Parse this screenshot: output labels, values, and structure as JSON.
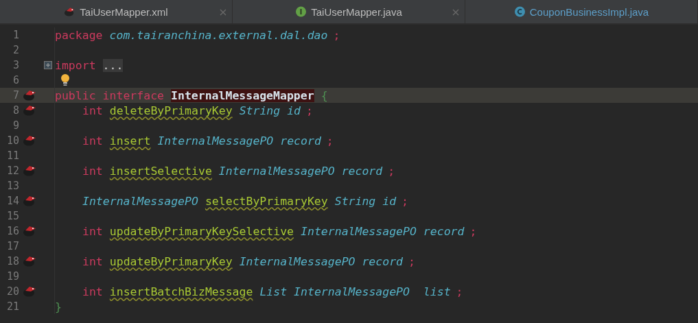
{
  "tabs": [
    {
      "label": "TaiUserMapper.xml",
      "kind": "bird",
      "selected": false,
      "modified": false,
      "closable": true
    },
    {
      "label": "TaiUserMapper.java",
      "kind": "interface",
      "selected": false,
      "modified": false,
      "closable": true
    },
    {
      "label": "CouponBusinessImpl.java",
      "kind": "class",
      "selected": false,
      "modified": true,
      "closable": false
    }
  ],
  "editor": {
    "lines": [
      {
        "number": "1",
        "kind": "plain",
        "current": false,
        "indented": false,
        "tokens": [
          {
            "text": "package",
            "kind": "keyword"
          },
          {
            "text": "com.tairanchina.external.dal.dao",
            "kind": "ident"
          },
          {
            "text": ";",
            "kind": "punct"
          }
        ]
      },
      {
        "number": "2",
        "kind": "plain",
        "current": false
      },
      {
        "number": "3",
        "kind": "fold",
        "current": false,
        "indented": false,
        "tokens": [
          {
            "text": "import",
            "kind": "keyword"
          },
          {
            "text": "...",
            "kind": "folded"
          }
        ]
      },
      {
        "number": "6",
        "kind": "bulb",
        "current": false,
        "indented": false
      },
      {
        "number": "7",
        "kind": "mapper",
        "current": true,
        "indented": false,
        "tokens": [
          {
            "text": "public",
            "kind": "keyword"
          },
          {
            "text": "interface",
            "kind": "keyword"
          },
          {
            "text": "InternalMessageMapper",
            "kind": "declared"
          },
          {
            "text": "{",
            "kind": "brace"
          }
        ]
      },
      {
        "number": "8",
        "kind": "mapper",
        "current": false,
        "indented": true,
        "tokens": [
          {
            "text": "int",
            "kind": "keyword"
          },
          {
            "text": "deleteByPrimaryKey",
            "kind": "method"
          },
          {
            "text": "String id",
            "kind": "ident"
          },
          {
            "text": ";",
            "kind": "punct"
          }
        ]
      },
      {
        "number": "9",
        "kind": "plain",
        "current": false
      },
      {
        "number": "10",
        "kind": "mapper",
        "current": false,
        "indented": true,
        "tokens": [
          {
            "text": "int",
            "kind": "keyword"
          },
          {
            "text": "insert",
            "kind": "method"
          },
          {
            "text": "InternalMessagePO record",
            "kind": "ident"
          },
          {
            "text": ";",
            "kind": "punct"
          }
        ]
      },
      {
        "number": "11",
        "kind": "plain",
        "current": false
      },
      {
        "number": "12",
        "kind": "mapper",
        "current": false,
        "indented": true,
        "tokens": [
          {
            "text": "int",
            "kind": "keyword"
          },
          {
            "text": "insertSelective",
            "kind": "method"
          },
          {
            "text": "InternalMessagePO record",
            "kind": "ident"
          },
          {
            "text": ";",
            "kind": "punct"
          }
        ]
      },
      {
        "number": "13",
        "kind": "plain",
        "current": false
      },
      {
        "number": "14",
        "kind": "mapper",
        "current": false,
        "indented": true,
        "tokens": [
          {
            "text": "InternalMessagePO",
            "kind": "ident"
          },
          {
            "text": "selectByPrimaryKey",
            "kind": "method"
          },
          {
            "text": "String id",
            "kind": "ident"
          },
          {
            "text": ";",
            "kind": "punct"
          }
        ]
      },
      {
        "number": "15",
        "kind": "plain",
        "current": false
      },
      {
        "number": "16",
        "kind": "mapper",
        "current": false,
        "indented": true,
        "tokens": [
          {
            "text": "int",
            "kind": "keyword"
          },
          {
            "text": "updateByPrimaryKeySelective",
            "kind": "method"
          },
          {
            "text": "InternalMessagePO record",
            "kind": "ident"
          },
          {
            "text": ";",
            "kind": "punct"
          }
        ]
      },
      {
        "number": "17",
        "kind": "plain",
        "current": false
      },
      {
        "number": "18",
        "kind": "mapper",
        "current": false,
        "indented": true,
        "tokens": [
          {
            "text": "int",
            "kind": "keyword"
          },
          {
            "text": "updateByPrimaryKey",
            "kind": "method"
          },
          {
            "text": "InternalMessagePO record",
            "kind": "ident"
          },
          {
            "text": ";",
            "kind": "punct"
          }
        ]
      },
      {
        "number": "19",
        "kind": "plain",
        "current": false
      },
      {
        "number": "20",
        "kind": "mapper",
        "current": false,
        "indented": true,
        "tokens": [
          {
            "text": "int",
            "kind": "keyword"
          },
          {
            "text": "insertBatchBizMessage",
            "kind": "method"
          },
          {
            "text": "List InternalMessagePO  list",
            "kind": "ident"
          },
          {
            "text": ";",
            "kind": "punct"
          }
        ]
      },
      {
        "number": "21",
        "kind": "plain",
        "current": false,
        "indented": false,
        "tokens": [
          {
            "text": "}",
            "kind": "brace"
          }
        ]
      }
    ]
  }
}
